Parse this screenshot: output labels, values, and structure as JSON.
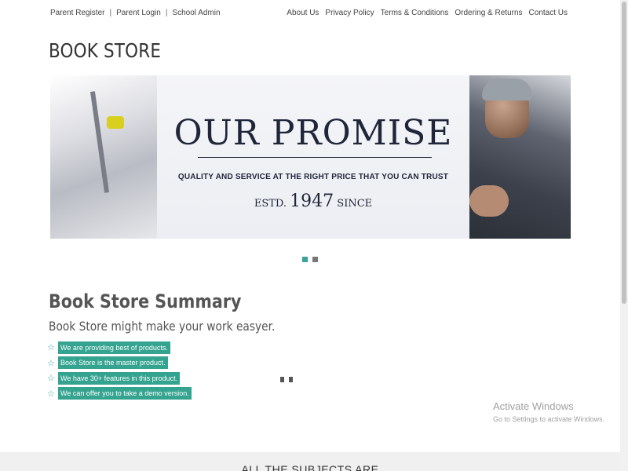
{
  "topbar": {
    "left_links": [
      {
        "label": "Parent Register"
      },
      {
        "label": "Parent Login"
      },
      {
        "label": "School Admin"
      }
    ],
    "separator": "|",
    "right_links": [
      {
        "label": "About Us"
      },
      {
        "label": "Privacy Policy"
      },
      {
        "label": "Terms & Conditions"
      },
      {
        "label": "Ordering & Returns"
      },
      {
        "label": "Contact Us"
      }
    ]
  },
  "site_title": "BOOK STORE",
  "banner": {
    "title": "OUR PROMISE",
    "subtitle": "QUALITY AND SERVICE AT THE RIGHT PRICE THAT YOU CAN TRUST",
    "estd_prefix": "ESTD.",
    "estd_year": "1947",
    "estd_suffix": "SINCE"
  },
  "slider": {
    "dots": [
      {
        "color": "#3aa395",
        "active": true
      },
      {
        "color": "#777777",
        "active": false
      }
    ]
  },
  "summary": {
    "heading": "Book Store Summary",
    "subheading": "Book Store might make your work easyer.",
    "items": [
      {
        "icon": "star-outline-icon",
        "text": "We are providing best of products."
      },
      {
        "icon": "star-outline-icon",
        "text": "Book Store is the master product."
      },
      {
        "icon": "star-outline-icon",
        "text": "We have 30+ features in this product."
      },
      {
        "icon": "star-outline-icon",
        "text": "We can offer you to take a demo version."
      }
    ]
  },
  "watermark": {
    "title": "Activate Windows",
    "subtitle": "Go to Settings to activate Windows."
  },
  "bottom_section": {
    "heading": "ALL THE SUBJECTS ARE"
  },
  "colors": {
    "accent": "#34a38f",
    "text": "#333333"
  }
}
